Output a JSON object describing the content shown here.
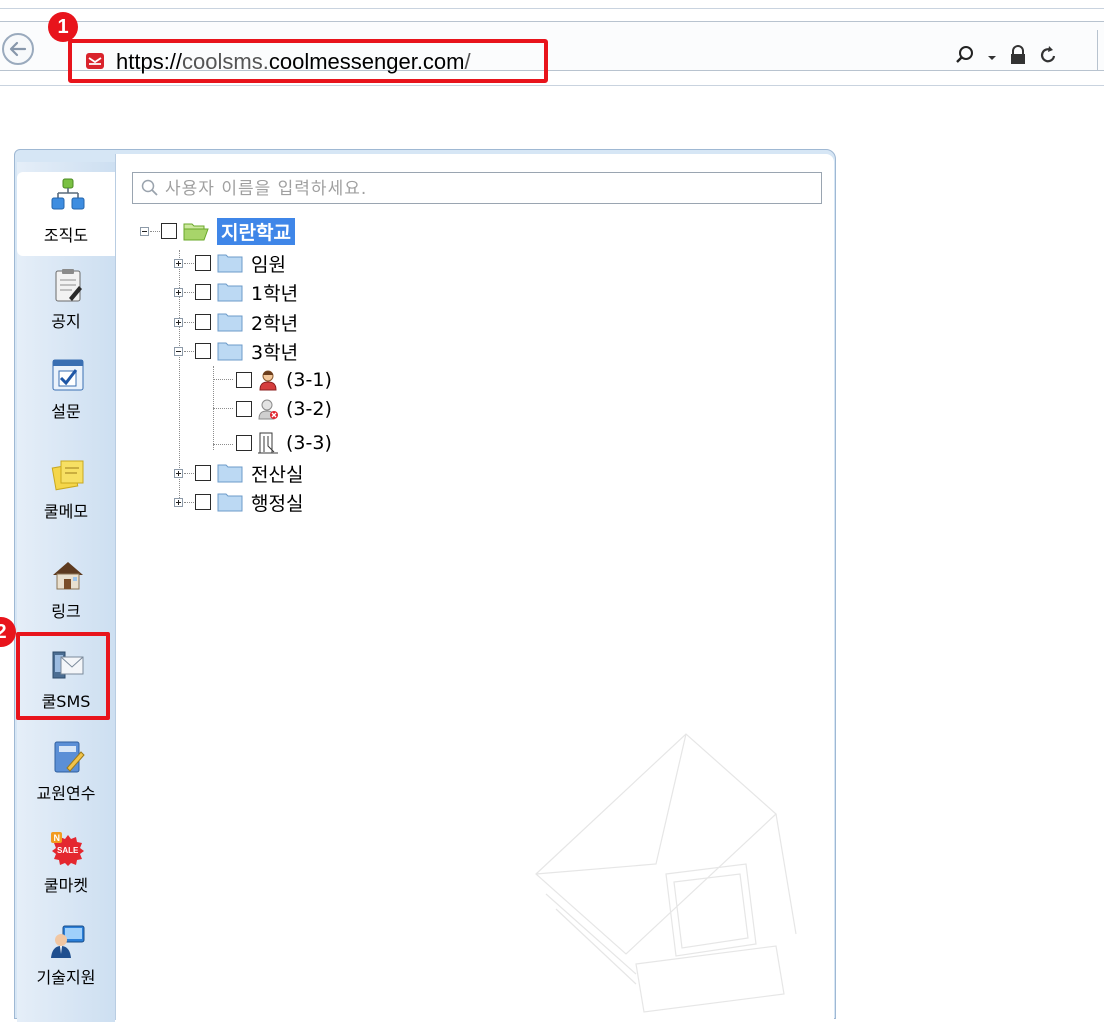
{
  "browser": {
    "url_scheme": "https://",
    "url_subdomain": "coolsms.",
    "url_domain": "coolmessenger.com",
    "url_path": "/",
    "icons": [
      "back-arrow-icon",
      "site-icon",
      "search-icon",
      "dropdown-icon",
      "lock-icon",
      "refresh-icon"
    ]
  },
  "annotations": {
    "badge_1": "1",
    "badge_2": "2",
    "color": "#e8141c"
  },
  "sidebar": {
    "items": [
      {
        "label": "조직도",
        "icon": "org-chart-icon"
      },
      {
        "label": "공지",
        "icon": "clipboard-icon"
      },
      {
        "label": "설문",
        "icon": "survey-check-icon"
      },
      {
        "label": "쿨메모",
        "icon": "memo-icon"
      },
      {
        "label": "링크",
        "icon": "house-icon"
      },
      {
        "label": "쿨SMS",
        "icon": "sms-envelope-icon"
      },
      {
        "label": "교원연수",
        "icon": "notebook-pen-icon"
      },
      {
        "label": "쿨마켓",
        "icon": "sale-badge-icon"
      },
      {
        "label": "기술지원",
        "icon": "support-computer-icon"
      }
    ],
    "active": "조직도"
  },
  "search": {
    "placeholder": "사용자 이름을 입력하세요."
  },
  "tree": {
    "root": "지란학교",
    "groups": [
      "임원",
      "1학년",
      "2학년",
      "3학년",
      "전산실",
      "행정실"
    ],
    "users": [
      "(3-1)",
      "(3-2)",
      "(3-3)"
    ]
  },
  "colors": {
    "accent": "#3f86e8",
    "sidebar": "#d6e6f5",
    "highlight": "#e8141c"
  }
}
